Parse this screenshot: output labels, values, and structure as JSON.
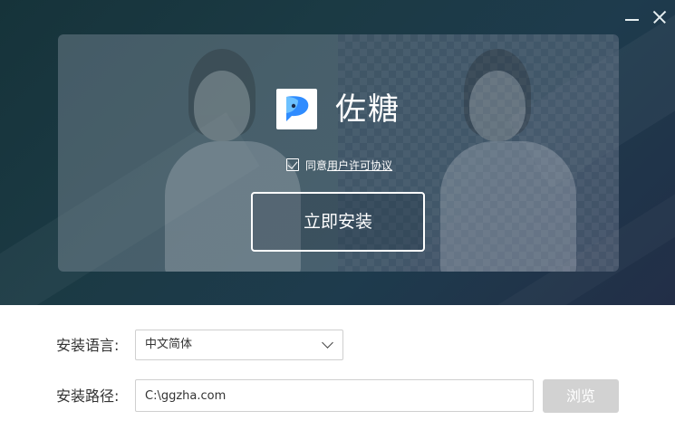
{
  "app": {
    "title": "佐糖",
    "logo_icon": "zuotang-logo-icon",
    "logo_color": "#2f8cff"
  },
  "window": {
    "minimize_icon": "minimize-icon",
    "close_icon": "close-icon"
  },
  "agreement": {
    "checked": true,
    "prefix": "同意",
    "link_text": "用户许可协议"
  },
  "install_button": {
    "label": "立即安装"
  },
  "form": {
    "language_label": "安装语言:",
    "language_value": "中文简体",
    "path_label": "安装路径:",
    "path_value": "C:\\ggzha.com",
    "browse_label": "浏览"
  },
  "colors": {
    "banner_dark": "#1b3a44",
    "browse_disabled": "#d2d2d2"
  }
}
